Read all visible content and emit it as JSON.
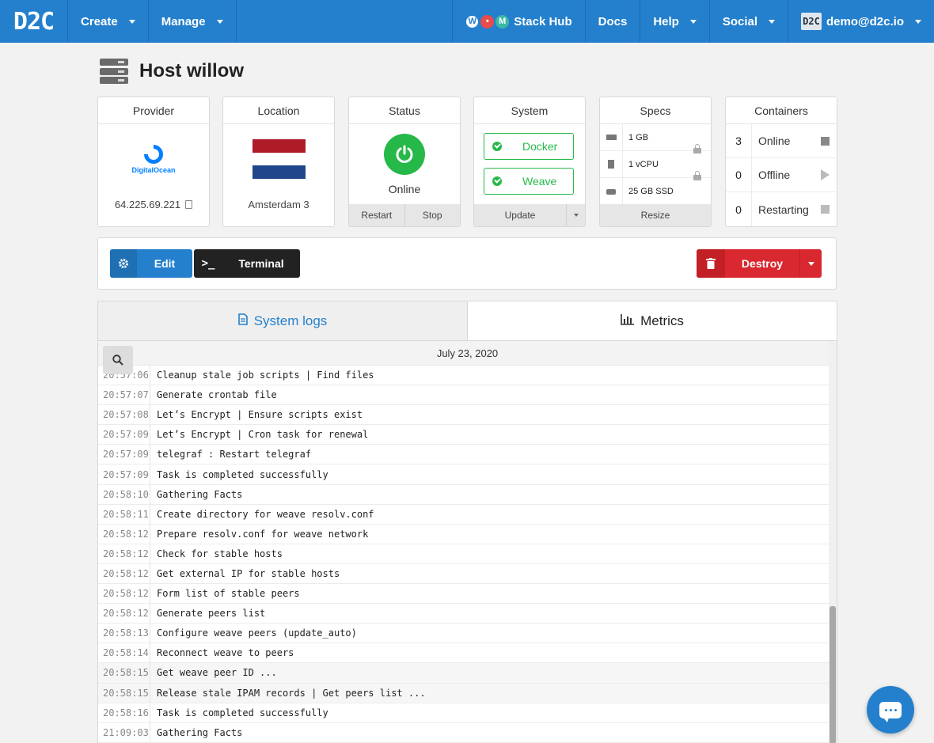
{
  "nav": {
    "logo": "D2C",
    "left_items": [
      {
        "label": "Create"
      },
      {
        "label": "Manage"
      }
    ],
    "stack_hub": "Stack Hub",
    "docs": "Docs",
    "help": "Help",
    "social": "Social",
    "user_badge": "D2C",
    "user_email": "demo@d2c.io"
  },
  "page": {
    "title": "Host willow"
  },
  "provider": {
    "head": "Provider",
    "name": "DigitalOcean",
    "ip": "64.225.69.221"
  },
  "location": {
    "head": "Location",
    "name": "Amsterdam 3",
    "flag_colors": [
      "#ae1c28",
      "#ffffff",
      "#21468b"
    ]
  },
  "status": {
    "head": "Status",
    "value": "Online",
    "restart": "Restart",
    "stop": "Stop",
    "color": "#27b84a"
  },
  "system": {
    "head": "System",
    "docker": "Docker",
    "weave": "Weave",
    "update": "Update"
  },
  "specs": {
    "head": "Specs",
    "ram": "1 GB",
    "cpu": "1 vCPU",
    "disk": "25 GB SSD",
    "resize": "Resize"
  },
  "containers": {
    "head": "Containers",
    "online_count": "3",
    "online": "Online",
    "offline_count": "0",
    "offline": "Offline",
    "restarting_count": "0",
    "restarting": "Restarting"
  },
  "actions": {
    "edit": "Edit",
    "terminal": "Terminal",
    "destroy": "Destroy"
  },
  "tabs": {
    "system_logs": "System logs",
    "metrics": "Metrics"
  },
  "logs": {
    "date": "July 23, 2020",
    "rows": [
      {
        "time": "20:57:06",
        "msg": "Cleanup stale job scripts | Find files"
      },
      {
        "time": "20:57:07",
        "msg": "Generate crontab file"
      },
      {
        "time": "20:57:08",
        "msg": "Let’s Encrypt | Ensure scripts exist"
      },
      {
        "time": "20:57:09",
        "msg": "Let’s Encrypt | Cron task for renewal"
      },
      {
        "time": "20:57:09",
        "msg": "telegraf : Restart telegraf"
      },
      {
        "time": "20:57:09",
        "msg": "Task is completed successfully"
      },
      {
        "time": "20:58:10",
        "msg": "Gathering Facts"
      },
      {
        "time": "20:58:11",
        "msg": "Create directory for weave resolv.conf"
      },
      {
        "time": "20:58:12",
        "msg": "Prepare resolv.conf for weave network"
      },
      {
        "time": "20:58:12",
        "msg": "Check for stable hosts"
      },
      {
        "time": "20:58:12",
        "msg": "Get external IP for stable hosts"
      },
      {
        "time": "20:58:12",
        "msg": "Form list of stable peers"
      },
      {
        "time": "20:58:12",
        "msg": "Generate peers list"
      },
      {
        "time": "20:58:13",
        "msg": "Configure weave peers (update_auto)"
      },
      {
        "time": "20:58:14",
        "msg": "Reconnect weave to peers"
      },
      {
        "time": "20:58:15",
        "msg": "Get weave peer ID ..."
      },
      {
        "time": "20:58:15",
        "msg": "Release stale IPAM records | Get peers list ..."
      },
      {
        "time": "20:58:16",
        "msg": "Task is completed successfully"
      },
      {
        "time": "21:09:03",
        "msg": "Gathering Facts"
      }
    ]
  },
  "colors": {
    "brand": "#2480cd",
    "success": "#27b84a",
    "danger": "#d9282f"
  }
}
